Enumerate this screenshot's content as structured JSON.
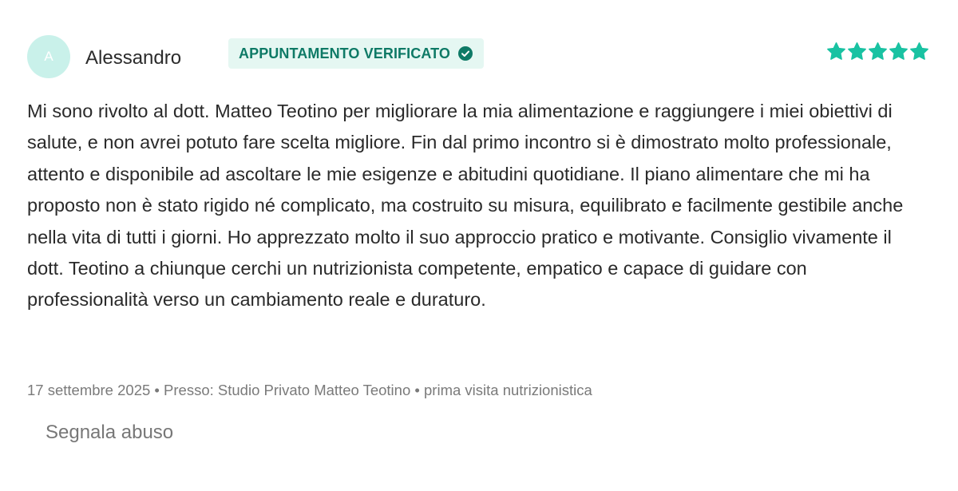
{
  "reviewer": {
    "avatar_initial": "A",
    "name": "Alessandro"
  },
  "badge": {
    "label": "APPUNTAMENTO VERIFICATO",
    "icon": "check-circle-icon"
  },
  "rating": {
    "stars": 5,
    "max": 5,
    "icon": "star-icon",
    "color": "#19c2a2"
  },
  "review": {
    "text": "Mi sono rivolto al dott. Matteo Teotino per migliorare la mia alimentazione e raggiungere i miei obiettivi di salute, e non avrei potuto fare scelta migliore. Fin dal primo incontro si è dimostrato molto professionale, attento e disponibile ad ascoltare le mie esigenze e abitudini quotidiane. Il piano alimentare che mi ha proposto non è stato rigido né complicato, ma costruito su misura, equilibrato e facilmente gestibile anche nella vita di tutti i giorni. Ho apprezzato molto il suo approccio pratico e motivante. Consiglio vivamente il dott. Teotino a chiunque cerchi un nutrizionista competente, empatico e capace di guidare con professionalità verso un cambiamento reale e duraturo."
  },
  "meta": {
    "date": "17 settembre 2025",
    "separator": "•",
    "location": "Presso: Studio Privato Matteo Teotino",
    "visit_type": "prima visita nutrizionistica"
  },
  "actions": {
    "report_label": "Segnala abuso"
  },
  "colors": {
    "accent": "#19c2a2",
    "badge_bg": "#e5f7f2",
    "badge_text": "#0e7a66",
    "avatar_bg": "#c9f1ea"
  }
}
